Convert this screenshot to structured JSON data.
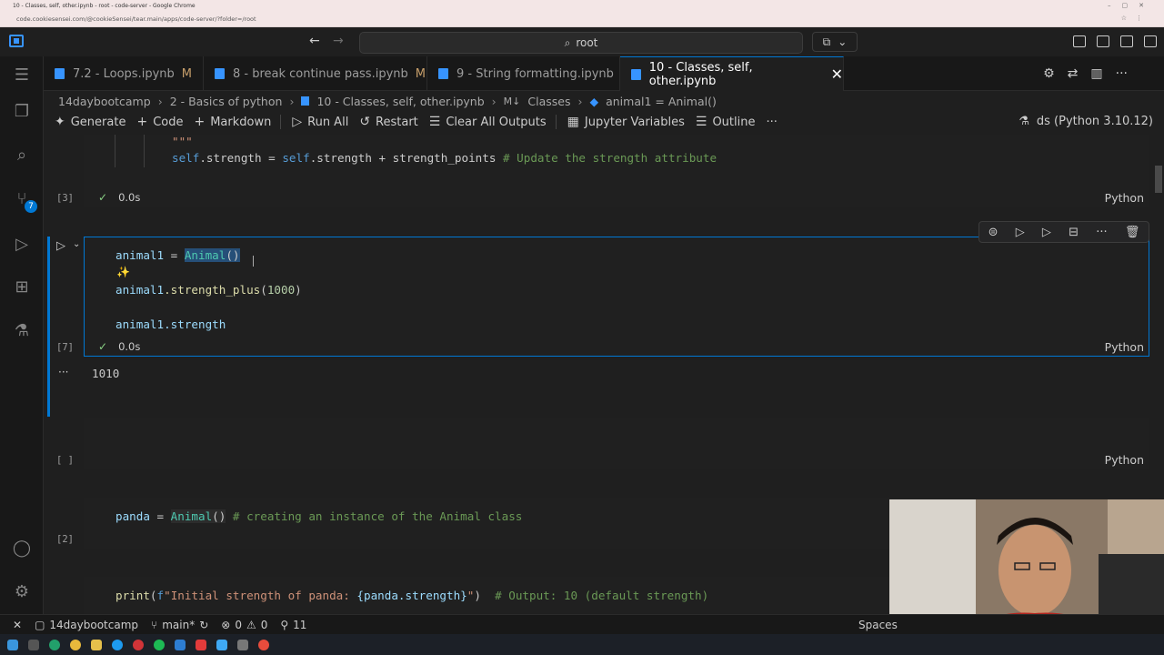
{
  "chrome": {
    "title": "10 - Classes, self, other.ipynb - root - code-server - Google Chrome",
    "url": "code.cookiesensei.com/@cookieSensei/tear.main/apps/code-server/?folder=/root"
  },
  "titlebar": {
    "search_text": "root"
  },
  "activity_bar": {
    "scm_badge": "7"
  },
  "tabs": [
    {
      "label": "7.2 - Loops.ipynb",
      "status": "M"
    },
    {
      "label": "8 - break continue pass.ipynb",
      "status": "M"
    },
    {
      "label": "9 - String formatting.ipynb",
      "status": ""
    },
    {
      "label": "10 - Classes, self, other.ipynb",
      "status": ""
    }
  ],
  "breadcrumb": [
    "14daybootcamp",
    "2 - Basics of python",
    "10 - Classes, self, other.ipynb",
    "Classes",
    "animal1 = Animal()"
  ],
  "toolbar": {
    "generate": "Generate",
    "code": "Code",
    "markdown": "Markdown",
    "run_all": "Run All",
    "restart": "Restart",
    "clear_all_outputs": "Clear All Outputs",
    "jupyter_variables": "Jupyter Variables",
    "outline": "Outline",
    "more": "···",
    "kernel": "ds (Python 3.10.12)"
  },
  "cells": {
    "cell3": {
      "docstring_end": "\"\"\"",
      "code_self1": "self",
      "code_mid": ".strength = ",
      "code_self2": "self",
      "code_rest": ".strength + strength_points",
      "comment": "# Update the strength attribute",
      "exec_count": "[3]",
      "time": "0.0s",
      "language": "Python"
    },
    "cell7": {
      "line1_var": "animal1",
      "line1_eq": " = ",
      "line1_cls": "Animal",
      "line1_paren": "()",
      "line2_var": "animal1",
      "line2_fn": ".strength_plus",
      "line2_open": "(",
      "line2_num": "1000",
      "line2_close": ")",
      "line3_var": "animal1",
      "line3_attr": ".strength",
      "exec_count": "[7]",
      "time": "0.0s",
      "language": "Python",
      "output": "1010",
      "output_more": "···"
    },
    "empty_cell": {
      "exec_count": "[ ]",
      "language": "Python"
    },
    "cell2": {
      "var": "panda",
      "eq": " = ",
      "cls": "Animal",
      "paren": "()",
      "comment": " # creating an instance of the Animal class",
      "exec_count": "[2]"
    },
    "cell_print": {
      "fn": "print",
      "open": "(",
      "fstr_prefix": "f",
      "str1": "\"Initial strength of panda: ",
      "interp": "{panda.strength}",
      "str2": "\"",
      "close": ")",
      "comment": "  # Output: 10 (default strength)"
    }
  },
  "statusbar": {
    "workspace": "14daybootcamp",
    "branch": "main*",
    "errors": "0",
    "warnings": "0",
    "ports": "11",
    "spaces": "Spaces"
  }
}
